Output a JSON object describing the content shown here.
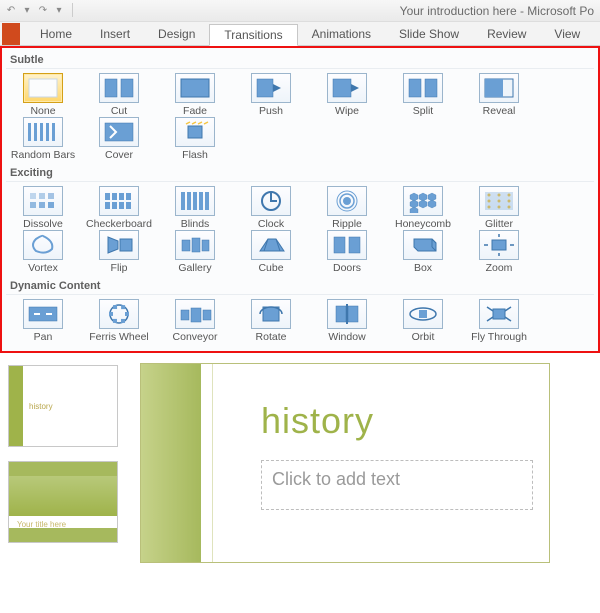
{
  "title": "Your introduction here  -  Microsoft Po",
  "tabs": [
    "Home",
    "Insert",
    "Design",
    "Transitions",
    "Animations",
    "Slide Show",
    "Review",
    "View"
  ],
  "active_tab": 3,
  "sections": [
    {
      "name": "Subtle",
      "items": [
        "None",
        "Cut",
        "Fade",
        "Push",
        "Wipe",
        "Split",
        "Reveal",
        "Random Bars",
        "Cover",
        "Flash"
      ],
      "selected": 0
    },
    {
      "name": "Exciting",
      "items": [
        "Dissolve",
        "Checkerboard",
        "Blinds",
        "Clock",
        "Ripple",
        "Honeycomb",
        "Glitter",
        "Vortex",
        "Flip",
        "Gallery",
        "Cube",
        "Doors",
        "Box",
        "Zoom"
      ]
    },
    {
      "name": "Dynamic Content",
      "items": [
        "Pan",
        "Ferris Wheel",
        "Conveyor",
        "Rotate",
        "Window",
        "Orbit",
        "Fly Through"
      ]
    }
  ],
  "thumbs": {
    "label1": "history",
    "label2": "Your title here"
  },
  "slide": {
    "title": "history",
    "placeholder": "Click to add text"
  }
}
